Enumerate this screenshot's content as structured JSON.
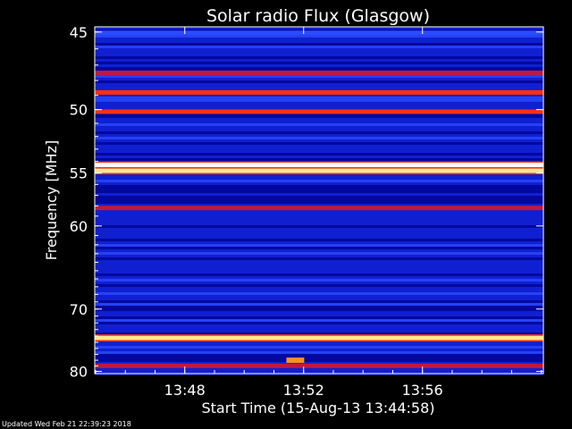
{
  "chart_data": {
    "type": "heatmap",
    "title": "Solar radio Flux (Glasgow)",
    "xlabel": "Start Time (15-Aug-13 13:44:58)",
    "ylabel": "Frequency [MHz]",
    "footer": "Updated Wed Feb 21 22:39:23 2018",
    "x_range_minutes": [
      0,
      15.1
    ],
    "x_ticks": [
      {
        "label": "13:48",
        "minutes": 3.03
      },
      {
        "label": "13:52",
        "minutes": 7.03
      },
      {
        "label": "13:56",
        "minutes": 11.03
      }
    ],
    "y_scale": "reciprocal",
    "y_range_mhz": [
      44.7,
      80.4
    ],
    "y_ticks": [
      {
        "label": "45",
        "mhz": 45
      },
      {
        "label": "50",
        "mhz": 50
      },
      {
        "label": "55",
        "mhz": 55
      },
      {
        "label": "60",
        "mhz": 60
      },
      {
        "label": "70",
        "mhz": 70
      },
      {
        "label": "80",
        "mhz": 80
      }
    ],
    "colormap": [
      "#00008c",
      "#1020d0",
      "#2c4cff",
      "#c01840",
      "#ff3010",
      "#ff9020",
      "#ffe890",
      "#ffffff"
    ],
    "emission_bands": [
      {
        "mhz": 45.05,
        "intensity": 0.35
      },
      {
        "mhz": 47.5,
        "intensity": 0.55
      },
      {
        "mhz": 48.8,
        "intensity": 0.6
      },
      {
        "mhz": 50.15,
        "intensity": 0.7
      },
      {
        "mhz": 54.3,
        "intensity": 1.0
      },
      {
        "mhz": 54.8,
        "intensity": 0.9
      },
      {
        "mhz": 58.2,
        "intensity": 0.5
      },
      {
        "mhz": 74.3,
        "intensity": 0.95
      },
      {
        "mhz": 79.0,
        "intensity": 0.45
      }
    ],
    "bursts": [
      {
        "mhz": 78.0,
        "start_min": 6.45,
        "end_min": 7.05,
        "intensity": 0.85
      }
    ]
  }
}
